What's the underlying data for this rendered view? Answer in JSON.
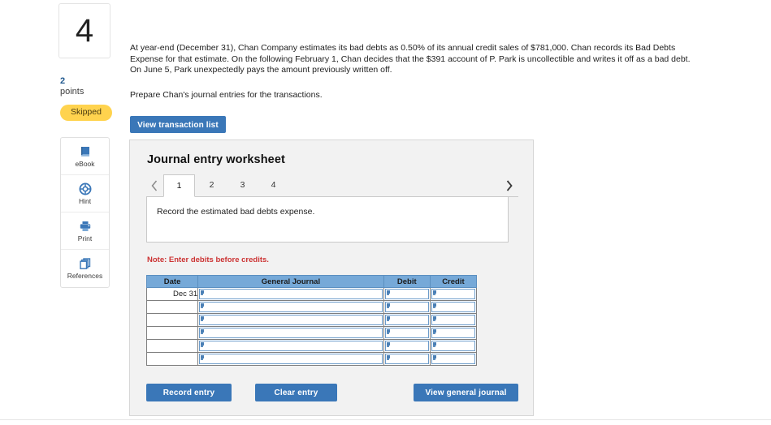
{
  "question": {
    "number": "4",
    "points_value": "2",
    "points_label": "points",
    "status_badge": "Skipped",
    "paragraph_1": "At year-end (December 31), Chan Company estimates its bad debts as 0.50% of its annual credit sales of $781,000. Chan records its Bad Debts Expense for that estimate. On the following February 1, Chan decides that the $391 account of P. Park is uncollectible and writes it off as a bad debt. On June 5, Park unexpectedly pays the amount previously written off.",
    "paragraph_2": "Prepare Chan's journal entries for the transactions."
  },
  "tools": [
    {
      "label": "eBook",
      "icon": "book-icon"
    },
    {
      "label": "Hint",
      "icon": "lifebuoy-icon"
    },
    {
      "label": "Print",
      "icon": "printer-icon"
    },
    {
      "label": "References",
      "icon": "copy-pages-icon"
    }
  ],
  "toolbar": {
    "view_transaction_list": "View transaction list"
  },
  "worksheet": {
    "title": "Journal entry worksheet",
    "prev_icon": "chevron-left-icon",
    "next_icon": "chevron-right-icon",
    "tabs": [
      {
        "label": "1",
        "active": true
      },
      {
        "label": "2",
        "active": false
      },
      {
        "label": "3",
        "active": false
      },
      {
        "label": "4",
        "active": false
      }
    ],
    "instruction": "Record the estimated bad debts expense.",
    "note": "Note: Enter debits before credits.",
    "table": {
      "columns": [
        "Date",
        "General Journal",
        "Debit",
        "Credit"
      ],
      "rows": [
        {
          "date": "Dec 31",
          "general_journal": "",
          "debit": "",
          "credit": ""
        },
        {
          "date": "",
          "general_journal": "",
          "debit": "",
          "credit": ""
        },
        {
          "date": "",
          "general_journal": "",
          "debit": "",
          "credit": ""
        },
        {
          "date": "",
          "general_journal": "",
          "debit": "",
          "credit": ""
        },
        {
          "date": "",
          "general_journal": "",
          "debit": "",
          "credit": ""
        },
        {
          "date": "",
          "general_journal": "",
          "debit": "",
          "credit": ""
        }
      ]
    },
    "footer": {
      "record_entry": "Record entry",
      "clear_entry": "Clear entry",
      "view_general_journal": "View general journal"
    }
  },
  "colors": {
    "primary_blue": "#3a77b8",
    "table_header_blue": "#76a9d8",
    "badge_yellow": "#ffd34e",
    "note_red": "#cc3333",
    "panel_gray": "#f2f2f2"
  }
}
